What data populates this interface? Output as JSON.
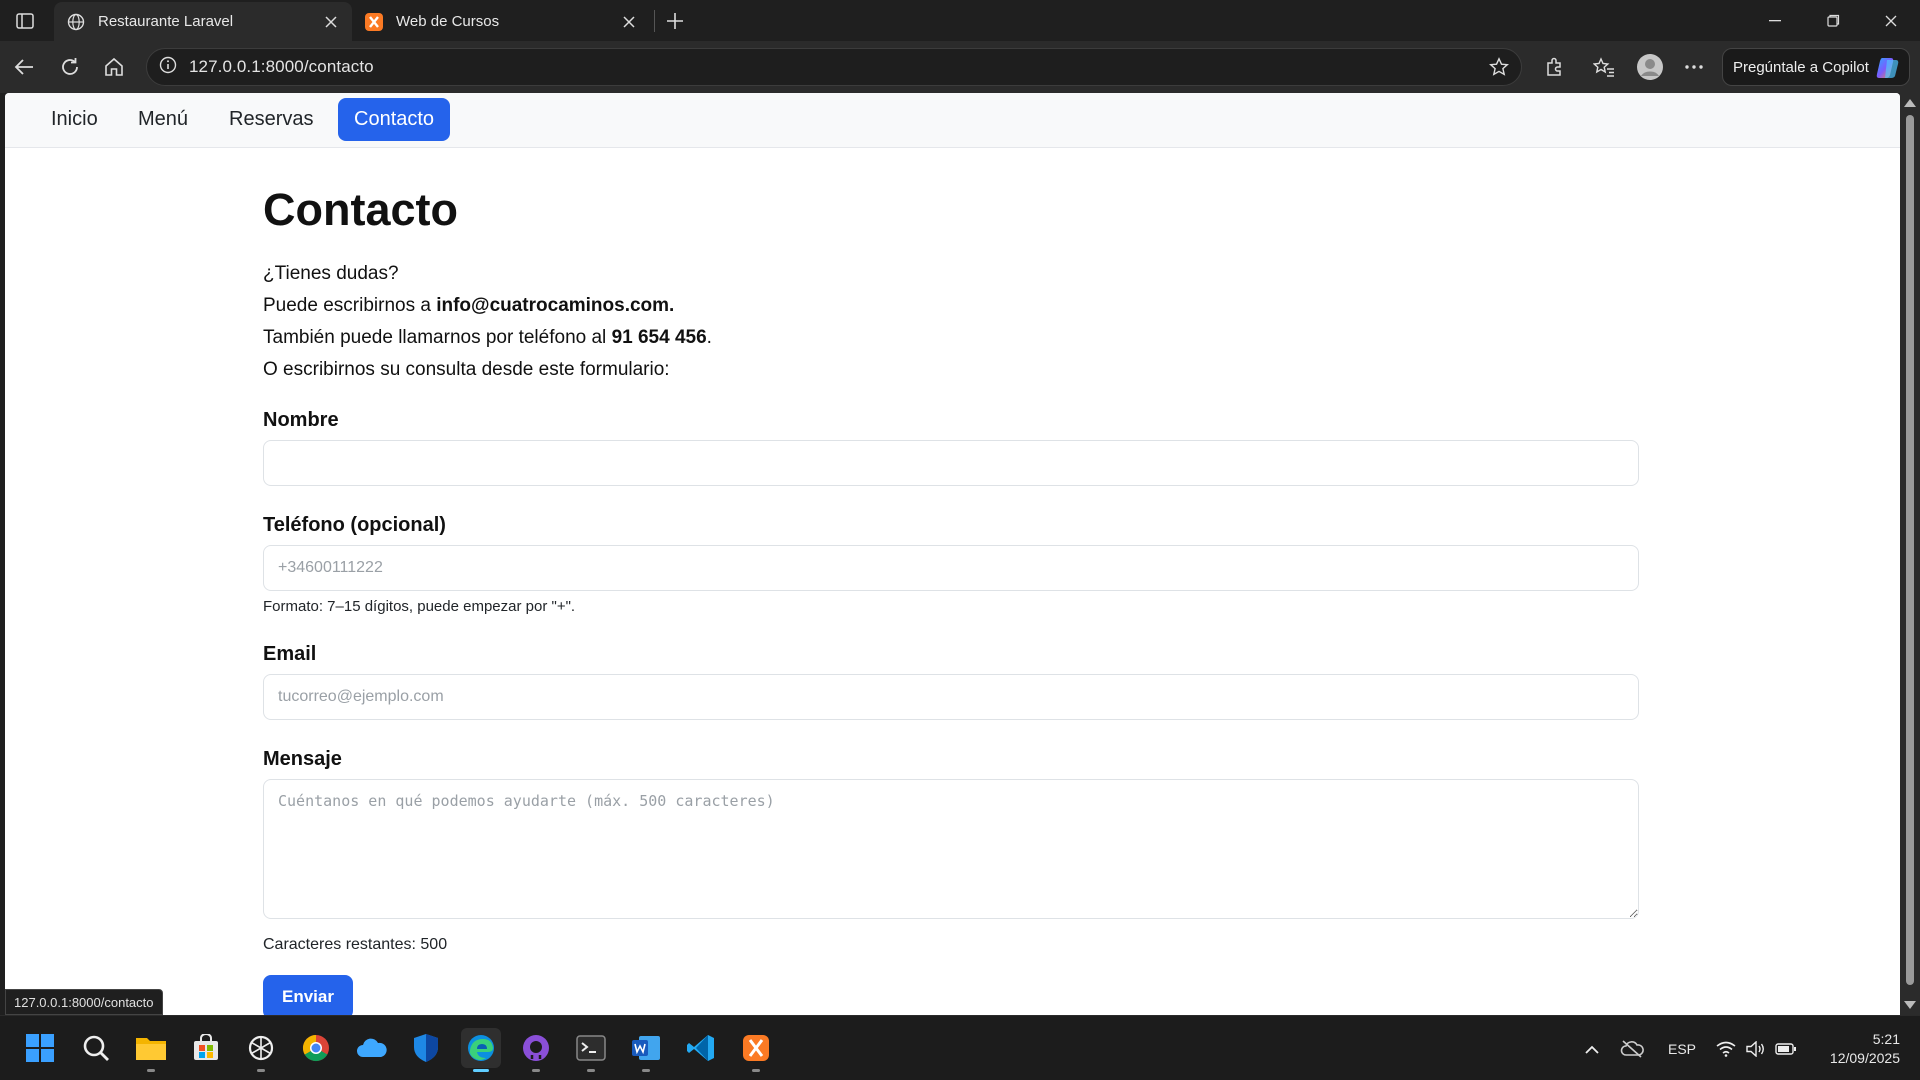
{
  "browser": {
    "tabs": [
      {
        "title": "Restaurante Laravel",
        "icon": "globe-icon",
        "active": true
      },
      {
        "title": "Web de Cursos",
        "icon": "xampp-icon",
        "active": false
      }
    ],
    "url": "127.0.0.1:8000/contacto",
    "copilot_label": "Pregúntale a Copilot",
    "status_url": "127.0.0.1:8000/contacto"
  },
  "site_nav": {
    "items": [
      {
        "label": "Inicio",
        "active": false
      },
      {
        "label": "Menú",
        "active": false
      },
      {
        "label": "Reservas",
        "active": false
      },
      {
        "label": "Contacto",
        "active": true
      }
    ]
  },
  "page": {
    "title": "Contacto",
    "intro": {
      "line1": "¿Tienes dudas?",
      "line2_prefix": "Puede escribirnos a ",
      "email": "info@cuatrocaminos.com.",
      "line3_prefix": "También puede llamarnos por teléfono al ",
      "phone": "91 654 456",
      "line3_suffix": ".",
      "line4": "O escribirnos su consulta desde este formulario:"
    },
    "form": {
      "name_label": "Nombre",
      "name_value": "",
      "phone_label": "Teléfono (opcional)",
      "phone_placeholder": "+34600111222",
      "phone_help": "Formato: 7–15 dígitos, puede empezar por \"+\".",
      "email_label": "Email",
      "email_placeholder": "tucorreo@ejemplo.com",
      "message_label": "Mensaje",
      "message_placeholder": "Cuéntanos en qué podemos ayudarte (máx. 500 caracteres)",
      "chars_remaining_label": "Caracteres restantes: ",
      "chars_remaining": "500",
      "submit_label": "Enviar"
    }
  },
  "taskbar": {
    "apps": [
      "windows-start-icon",
      "search-icon",
      "file-explorer-icon",
      "store-icon",
      "chatgpt-icon",
      "chrome-icon",
      "onedrive-icon",
      "defender-icon",
      "edge-icon",
      "github-desktop-icon",
      "terminal-icon",
      "word-icon",
      "vscode-icon",
      "xampp-icon"
    ],
    "language": "ESP",
    "time": "5:21",
    "date": "12/09/2025"
  },
  "colors": {
    "accent": "#2563eb",
    "browser_dark": "#1f1f1f",
    "page_bg": "#ffffff"
  }
}
